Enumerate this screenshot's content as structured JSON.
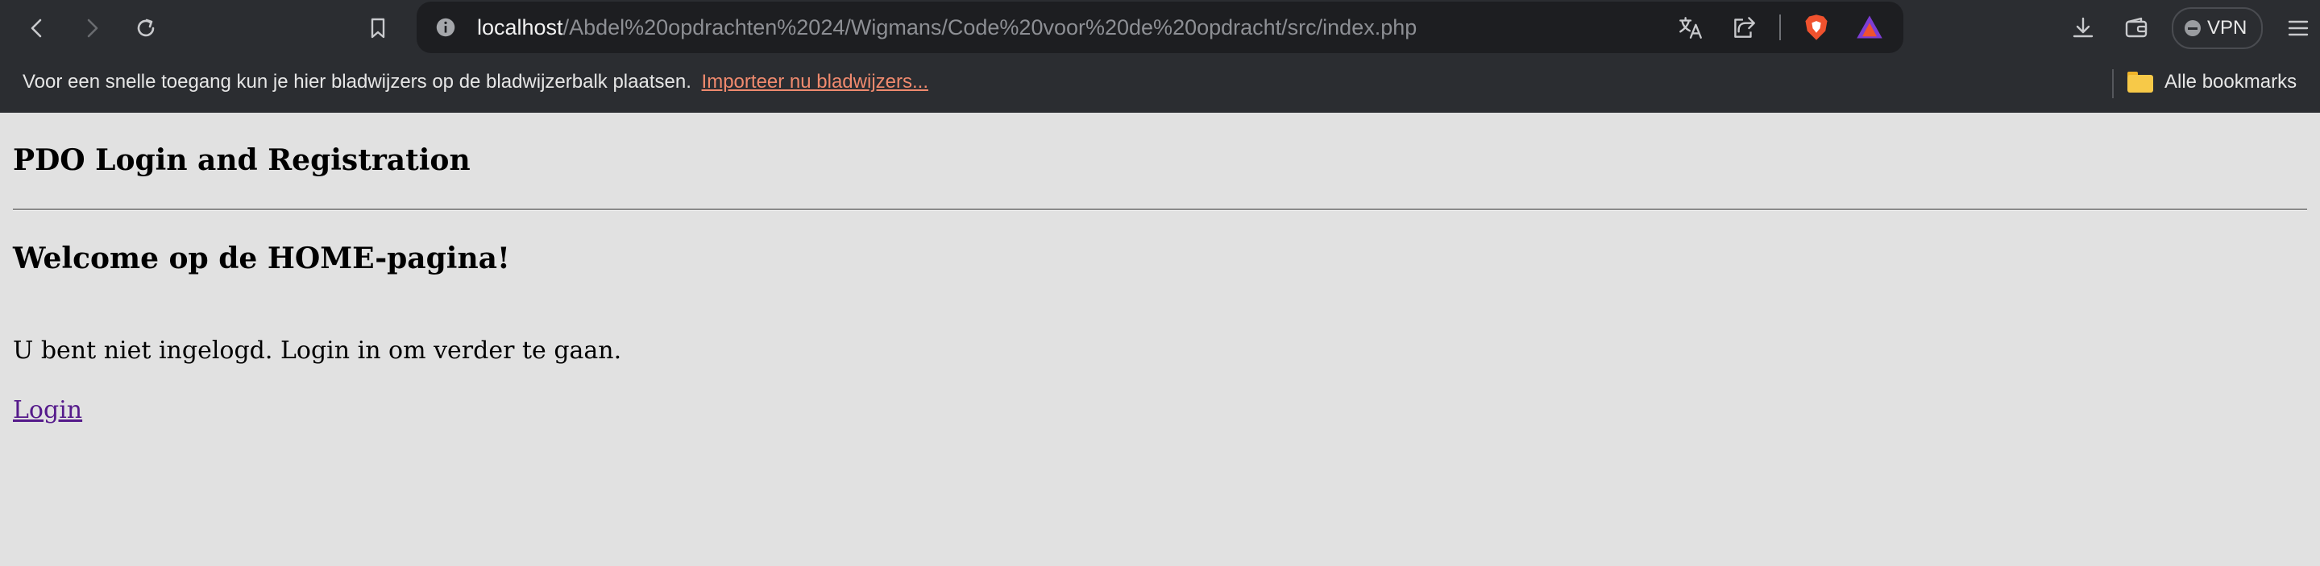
{
  "browser": {
    "url_host": "localhost",
    "url_path": "/Abdel%20opdrachten%2024/Wigmans/Code%20voor%20de%20opdracht/src/index.php",
    "vpn_label": "VPN",
    "icons": [
      "back-icon",
      "forward-icon",
      "reload-icon",
      "bookmark-icon",
      "site-info-icon",
      "translate-icon",
      "share-icon",
      "brave-shields-icon",
      "brave-rewards-icon",
      "downloads-icon",
      "wallet-icon",
      "menu-icon",
      "folder-icon"
    ]
  },
  "bookmarks_bar": {
    "message": "Voor een snelle toegang kun je hier bladwijzers op de bladwijzerbalk plaatsen.",
    "import_link": "Importeer nu bladwijzers...",
    "all_bookmarks": "Alle bookmarks"
  },
  "page": {
    "title": "PDO Login and Registration",
    "welcome": "Welcome op de HOME-pagina!",
    "not_logged_in": "U bent niet ingelogd. Login in om verder te gaan.",
    "login_link": "Login"
  }
}
